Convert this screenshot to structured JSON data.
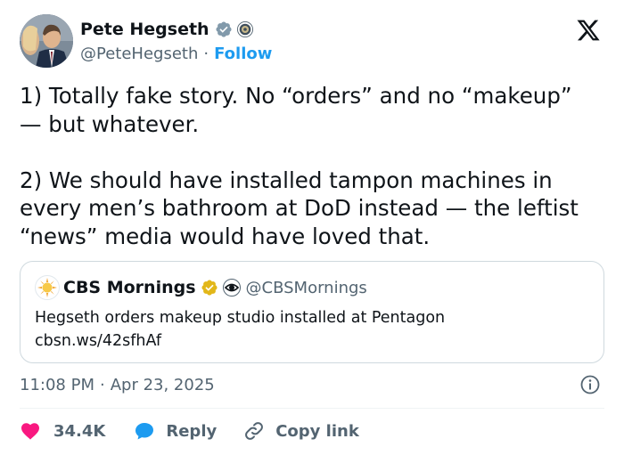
{
  "author": {
    "name": "Pete Hegseth",
    "handle": "@PeteHegseth",
    "follow_label": "Follow",
    "separator": "·"
  },
  "tweet": {
    "text": "1) Totally fake story. No “orders” and no “makeup”\n— but whatever.\n\n2) We should have installed tampon machines in\nevery men’s bathroom at DoD instead — the leftist\n“news” media would have loved that."
  },
  "quote": {
    "name": "CBS Mornings",
    "handle": "@CBSMornings",
    "text": "Hegseth orders makeup studio installed at Pentagon\ncbsn.ws/42sfhAf"
  },
  "meta": {
    "time": "11:08 PM",
    "separator": "·",
    "date": "Apr 23, 2025"
  },
  "actions": {
    "likes": "34.4K",
    "reply": "Reply",
    "copy_link": "Copy link"
  },
  "colors": {
    "like": "#f91880",
    "reply": "#1d9bf0",
    "verified_blue": "#829aab",
    "verified_gold": "#e2b719",
    "link": "#1d9bf0"
  },
  "icons": [
    "x-logo-icon",
    "verified-badge-icon",
    "government-seal-icon",
    "info-icon",
    "heart-icon",
    "reply-bubble-icon",
    "link-icon"
  ]
}
